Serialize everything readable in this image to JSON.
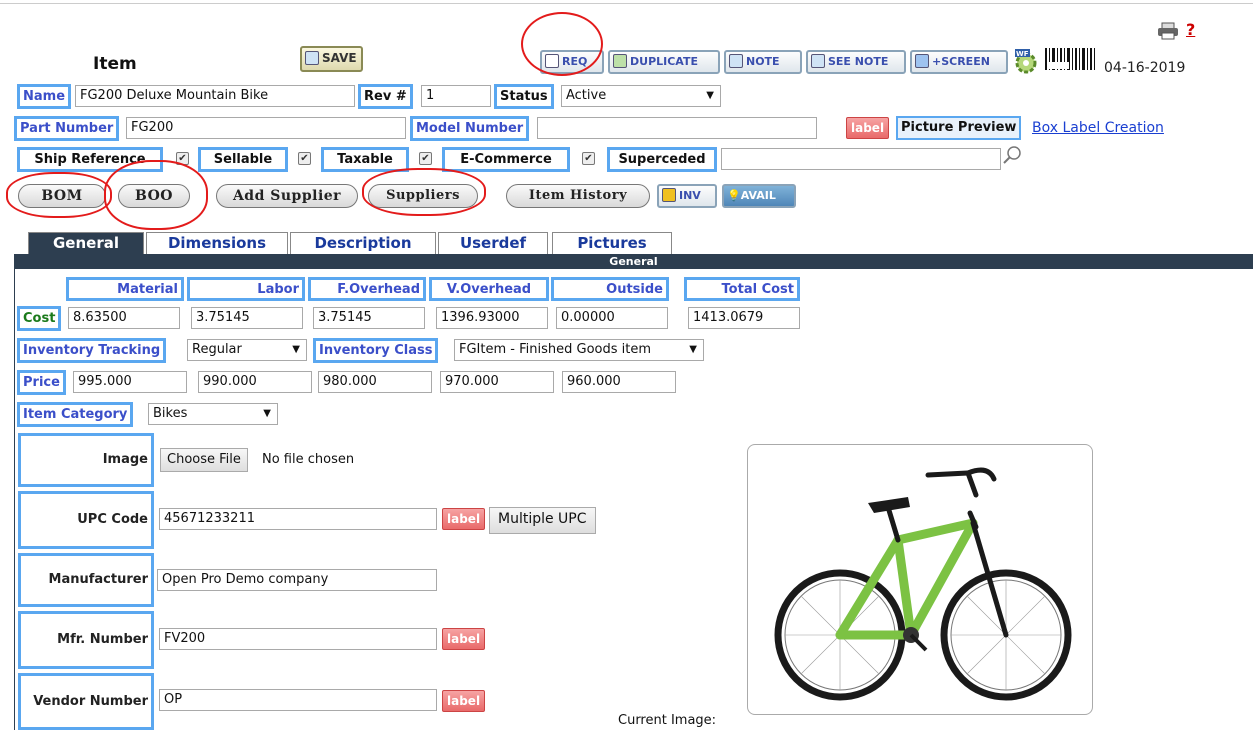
{
  "header": {
    "title": "Item",
    "save_label": "SAVE",
    "date": "04-16-2019",
    "help_mark": "?",
    "toolbar": [
      {
        "label": "REQ"
      },
      {
        "label": "DUPLICATE"
      },
      {
        "label": "NOTE"
      },
      {
        "label": "SEE NOTE"
      },
      {
        "label": "+SCREEN"
      }
    ]
  },
  "fields": {
    "name_label": "Name",
    "name_value": "FG200 Deluxe Mountain Bike",
    "rev_label": "Rev #",
    "rev_value": "1",
    "status_label": "Status",
    "status_value": "Active",
    "part_label": "Part Number",
    "part_value": "FG200",
    "model_label": "Model Number",
    "model_value": "",
    "label_btn": "label",
    "picture_preview": "Picture Preview",
    "box_label_link": "Box Label Creation",
    "ship_ref_label": "Ship Reference",
    "sellable_label": "Sellable",
    "taxable_label": "Taxable",
    "ecommerce_label": "E-Commerce",
    "superceded_label": "Superceded",
    "superceded_value": ""
  },
  "actions": {
    "bom": "BOM",
    "boo": "BOO",
    "add_supplier": "Add Supplier",
    "suppliers": "Suppliers",
    "item_history": "Item History",
    "inv": "INV",
    "avail": "AVAIL"
  },
  "tabs": [
    "General",
    "Dimensions",
    "Description",
    "Userdef",
    "Pictures"
  ],
  "section_title": "General",
  "cost": {
    "headers": [
      "Material",
      "Labor",
      "F.Overhead",
      "V.Overhead",
      "Outside",
      "Total Cost"
    ],
    "label": "Cost",
    "values": [
      "8.63500",
      "3.75145",
      "3.75145",
      "1396.93000",
      "0.00000",
      "1413.0679"
    ]
  },
  "inventory": {
    "tracking_label": "Inventory Tracking",
    "tracking_value": "Regular",
    "class_label": "Inventory Class",
    "class_value": "FGItem - Finished Goods item"
  },
  "price": {
    "label": "Price",
    "values": [
      "995.000",
      "990.000",
      "980.000",
      "970.000",
      "960.000"
    ]
  },
  "category": {
    "label": "Item Category",
    "value": "Bikes"
  },
  "details": {
    "image_label": "Image",
    "choose_file": "Choose File",
    "no_file": "No file chosen",
    "upc_label": "UPC Code",
    "upc_value": "45671233211",
    "multiple_upc": "Multiple UPC",
    "manufacturer_label": "Manufacturer",
    "manufacturer_value": "Open Pro Demo company",
    "mfr_number_label": "Mfr. Number",
    "mfr_number_value": "FV200",
    "vendor_number_label": "Vendor Number",
    "vendor_number_value": "OP",
    "current_image": "Current Image:"
  },
  "colors": {
    "label_border": "#5aa7f0",
    "label_text": "#3b4fc9",
    "tab_active": "#2d3e50",
    "annotation_red": "#e31b1b",
    "bike_green": "#7cc243"
  }
}
